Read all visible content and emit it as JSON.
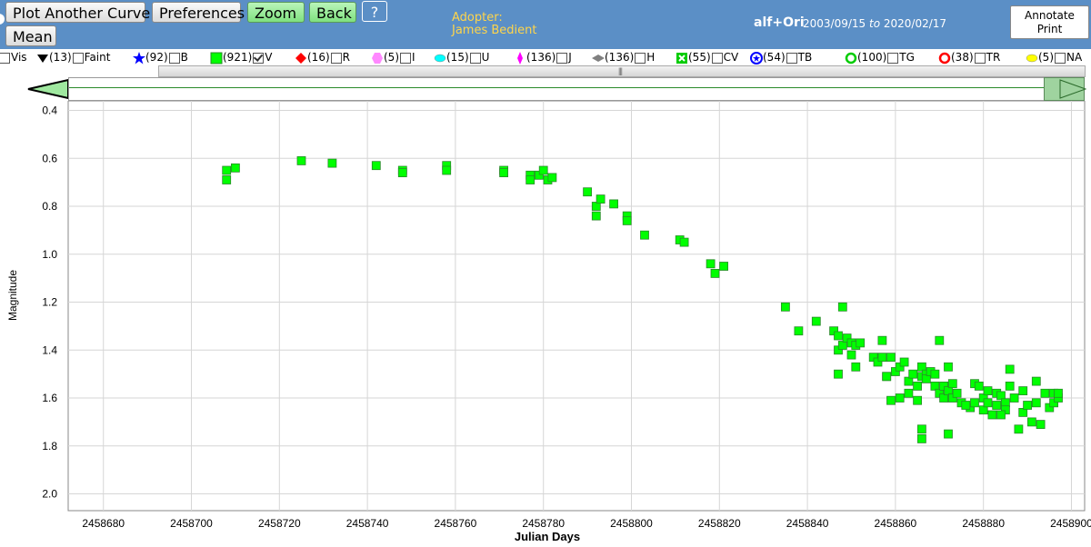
{
  "toolbar": {
    "plot_another_curve": "Plot Another Curve",
    "preferences": "Preferences",
    "zoom": "Zoom",
    "back": "Back",
    "help": "?",
    "mean": "Mean"
  },
  "adopter": {
    "label": "Adopter:",
    "name": "James Bedient"
  },
  "star": {
    "name": "alf+Ori",
    "date_from": "2003/09/15",
    "to_word": "to",
    "date_to": "2020/02/17"
  },
  "annotate": {
    "line1": "Annotate",
    "line2": "Print"
  },
  "legend": [
    {
      "icon": "none",
      "count": "",
      "label": "Vis",
      "checked": false
    },
    {
      "icon": "triangle-down-icon",
      "color": "#000000",
      "count": "(13)",
      "label": "Faint",
      "checked": false
    },
    {
      "icon": "star-icon",
      "color": "#0000ff",
      "count": "(92)",
      "label": "B",
      "checked": false
    },
    {
      "icon": "square-icon",
      "color": "#00ff00",
      "count": "(921)",
      "label": "V",
      "checked": true
    },
    {
      "icon": "diamond-icon",
      "color": "#ff0000",
      "count": "(16)",
      "label": "R",
      "checked": false
    },
    {
      "icon": "hexagon-icon",
      "color": "#ff88ff",
      "count": "(5)",
      "label": "I",
      "checked": false
    },
    {
      "icon": "ellipse-icon",
      "color": "#00ffff",
      "count": "(15)",
      "label": "U",
      "checked": false
    },
    {
      "icon": "thin-diamond-icon",
      "color": "#ff00ff",
      "count": "(136)",
      "label": "J",
      "checked": false
    },
    {
      "icon": "flat-diamond-icon",
      "color": "#808080",
      "count": "(136)",
      "label": "H",
      "checked": false
    },
    {
      "icon": "square-x-icon",
      "color": "#00cc00",
      "count": "(55)",
      "label": "CV",
      "checked": false
    },
    {
      "icon": "circle-star-icon",
      "color": "#0000ff",
      "count": "(54)",
      "label": "TB",
      "checked": false
    },
    {
      "icon": "circle-ring-icon",
      "color": "#00cc00",
      "count": "(100)",
      "label": "TG",
      "checked": false
    },
    {
      "icon": "circle-ring-icon",
      "color": "#ff0000",
      "count": "(38)",
      "label": "TR",
      "checked": false
    },
    {
      "icon": "ellipse-icon",
      "color": "#ffff00",
      "count": "(5)",
      "label": "NA",
      "checked": false
    }
  ],
  "colors": {
    "header_bg": "#5b8fc6",
    "adopter_text": "#ffd54a",
    "marker_fill": "#00ff00",
    "marker_stroke": "#2a8a2a"
  },
  "chart_data": {
    "type": "scatter",
    "xlabel": "Julian Days",
    "ylabel": "Magnitude",
    "xlim": [
      2458672,
      2458903
    ],
    "ylim": [
      2.07,
      0.36
    ],
    "y_inverted": true,
    "grid": true,
    "x_ticks": [
      2458680,
      2458700,
      2458720,
      2458740,
      2458760,
      2458780,
      2458800,
      2458820,
      2458840,
      2458860,
      2458880,
      2458900
    ],
    "y_ticks": [
      0.4,
      0.6,
      0.8,
      1.0,
      1.2,
      1.4,
      1.6,
      1.8,
      2.0
    ],
    "series": [
      {
        "marker": "square",
        "points": [
          [
            2458708,
            0.65
          ],
          [
            2458708,
            0.69
          ],
          [
            2458710,
            0.64
          ],
          [
            2458725,
            0.61
          ],
          [
            2458732,
            0.62
          ],
          [
            2458742,
            0.63
          ],
          [
            2458748,
            0.65
          ],
          [
            2458748,
            0.66
          ],
          [
            2458758,
            0.63
          ],
          [
            2458758,
            0.65
          ],
          [
            2458771,
            0.65
          ],
          [
            2458771,
            0.66
          ],
          [
            2458777,
            0.67
          ],
          [
            2458777,
            0.69
          ],
          [
            2458779,
            0.67
          ],
          [
            2458780,
            0.65
          ],
          [
            2458781,
            0.69
          ],
          [
            2458782,
            0.68
          ],
          [
            2458790,
            0.74
          ],
          [
            2458792,
            0.8
          ],
          [
            2458793,
            0.77
          ],
          [
            2458792,
            0.84
          ],
          [
            2458796,
            0.79
          ],
          [
            2458799,
            0.84
          ],
          [
            2458799,
            0.86
          ],
          [
            2458803,
            0.92
          ],
          [
            2458811,
            0.94
          ],
          [
            2458812,
            0.95
          ],
          [
            2458818,
            1.04
          ],
          [
            2458819,
            1.08
          ],
          [
            2458821,
            1.05
          ],
          [
            2458835,
            1.22
          ],
          [
            2458838,
            1.32
          ],
          [
            2458842,
            1.28
          ],
          [
            2458846,
            1.32
          ],
          [
            2458847,
            1.34
          ],
          [
            2458847,
            1.4
          ],
          [
            2458848,
            1.22
          ],
          [
            2458848,
            1.38
          ],
          [
            2458847,
            1.5
          ],
          [
            2458849,
            1.35
          ],
          [
            2458850,
            1.37
          ],
          [
            2458851,
            1.38
          ],
          [
            2458850,
            1.42
          ],
          [
            2458852,
            1.37
          ],
          [
            2458851,
            1.47
          ],
          [
            2458855,
            1.43
          ],
          [
            2458856,
            1.45
          ],
          [
            2458857,
            1.43
          ],
          [
            2458857,
            1.36
          ],
          [
            2458858,
            1.51
          ],
          [
            2458859,
            1.43
          ],
          [
            2458860,
            1.49
          ],
          [
            2458859,
            1.61
          ],
          [
            2458861,
            1.47
          ],
          [
            2458862,
            1.45
          ],
          [
            2458861,
            1.6
          ],
          [
            2458863,
            1.53
          ],
          [
            2458864,
            1.5
          ],
          [
            2458863,
            1.58
          ],
          [
            2458865,
            1.55
          ],
          [
            2458865,
            1.61
          ],
          [
            2458866,
            1.51
          ],
          [
            2458866,
            1.47
          ],
          [
            2458867,
            1.5
          ],
          [
            2458867,
            1.52
          ],
          [
            2458868,
            1.49
          ],
          [
            2458869,
            1.5
          ],
          [
            2458869,
            1.55
          ],
          [
            2458870,
            1.36
          ],
          [
            2458870,
            1.58
          ],
          [
            2458871,
            1.55
          ],
          [
            2458871,
            1.6
          ],
          [
            2458872,
            1.47
          ],
          [
            2458872,
            1.57
          ],
          [
            2458873,
            1.54
          ],
          [
            2458873,
            1.6
          ],
          [
            2458874,
            1.58
          ],
          [
            2458875,
            1.62
          ],
          [
            2458877,
            1.64
          ],
          [
            2458878,
            1.54
          ],
          [
            2458878,
            1.62
          ],
          [
            2458879,
            1.55
          ],
          [
            2458880,
            1.6
          ],
          [
            2458880,
            1.65
          ],
          [
            2458881,
            1.57
          ],
          [
            2458881,
            1.62
          ],
          [
            2458882,
            1.67
          ],
          [
            2458883,
            1.58
          ],
          [
            2458883,
            1.63
          ],
          [
            2458884,
            1.59
          ],
          [
            2458885,
            1.62
          ],
          [
            2458885,
            1.65
          ],
          [
            2458886,
            1.48
          ],
          [
            2458886,
            1.55
          ],
          [
            2458887,
            1.6
          ],
          [
            2458889,
            1.57
          ],
          [
            2458889,
            1.66
          ],
          [
            2458890,
            1.63
          ],
          [
            2458891,
            1.7
          ],
          [
            2458892,
            1.53
          ],
          [
            2458892,
            1.62
          ],
          [
            2458893,
            1.71
          ],
          [
            2458894,
            1.58
          ],
          [
            2458895,
            1.64
          ],
          [
            2458896,
            1.58
          ],
          [
            2458896,
            1.62
          ],
          [
            2458897,
            1.6
          ],
          [
            2458897,
            1.58
          ],
          [
            2458866,
            1.73
          ],
          [
            2458866,
            1.77
          ],
          [
            2458872,
            1.75
          ],
          [
            2458888,
            1.73
          ],
          [
            2458858,
            1.51
          ],
          [
            2458876,
            1.63
          ],
          [
            2458884,
            1.67
          ]
        ]
      }
    ]
  }
}
